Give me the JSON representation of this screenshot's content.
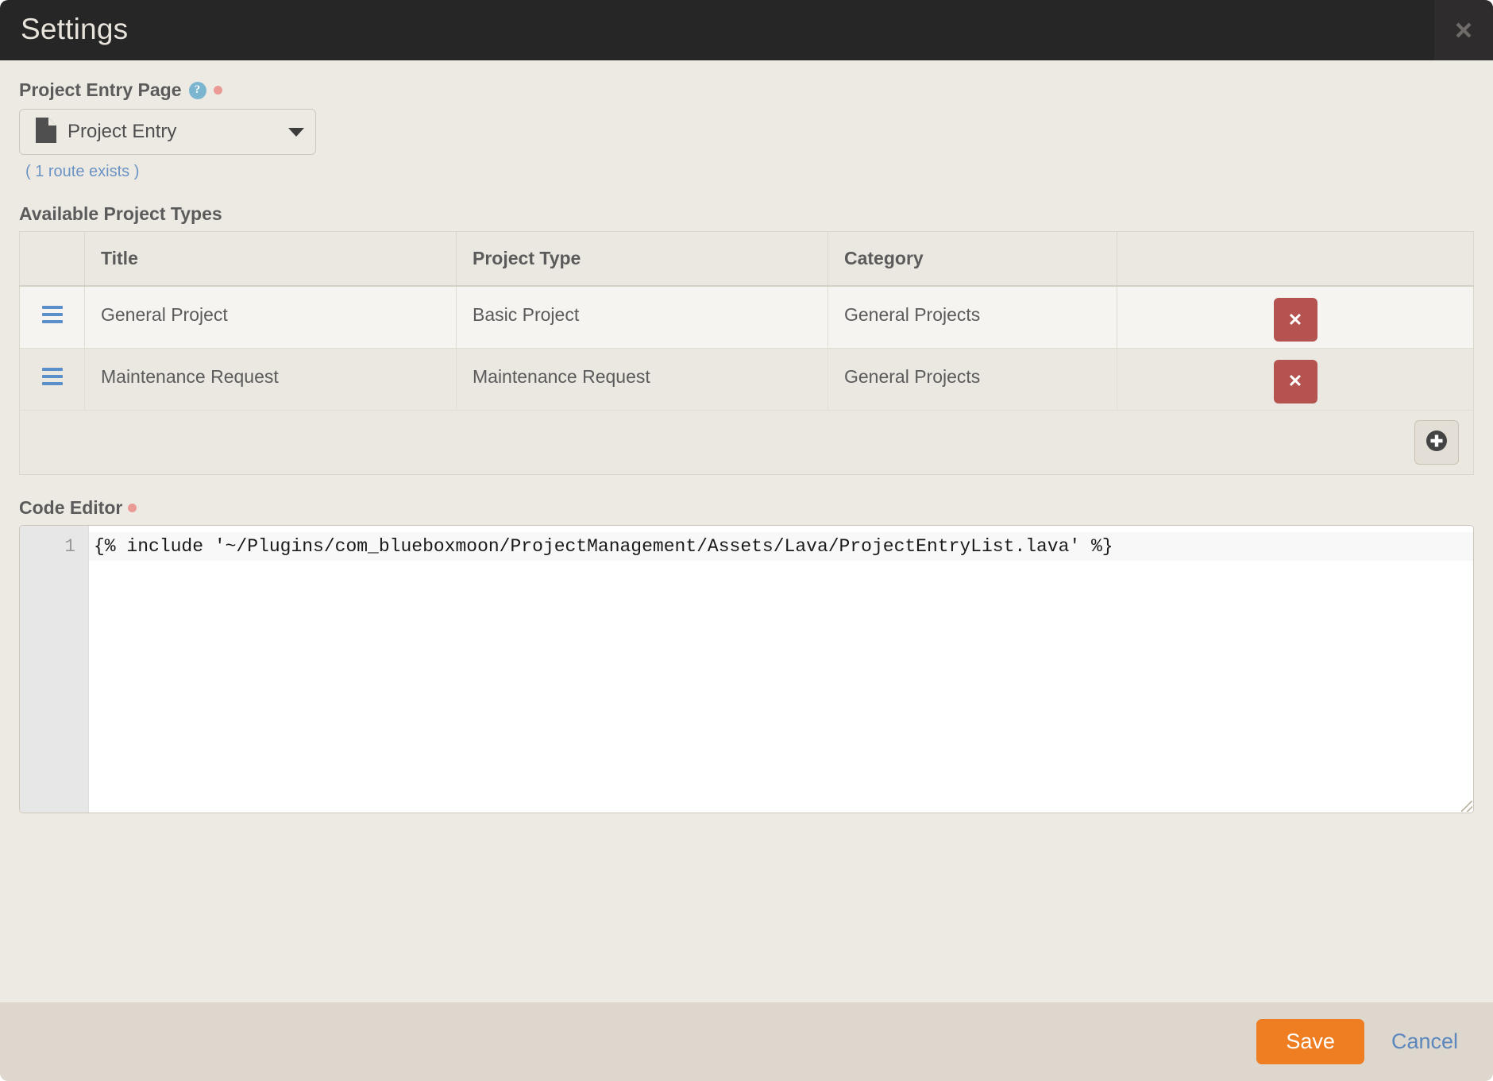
{
  "header": {
    "title": "Settings",
    "close_label": "×",
    "close_icon": "close-icon"
  },
  "page_entry": {
    "label": "Project Entry Page",
    "help_icon_glyph": "?",
    "required": true,
    "picker_icon": "file-icon",
    "picker_value": "Project Entry",
    "caret_icon": "chevron-down-icon",
    "route_note": "( 1 route exists )"
  },
  "project_types": {
    "section_label": "Available Project Types",
    "columns": [
      "",
      "Title",
      "Project Type",
      "Category",
      ""
    ],
    "rows": [
      {
        "handle_icon": "drag-handle-icon",
        "title": "General Project",
        "project_type": "Basic Project",
        "category": "General Projects",
        "delete_label": "✕"
      },
      {
        "handle_icon": "drag-handle-icon",
        "title": "Maintenance Request",
        "project_type": "Maintenance Request",
        "category": "General Projects",
        "delete_label": "✕"
      }
    ],
    "add_icon": "plus-circle-icon"
  },
  "code_editor": {
    "label": "Code Editor",
    "required": true,
    "line_numbers": [
      "1"
    ],
    "lines": [
      "{% include '~/Plugins/com_blueboxmoon/ProjectManagement/Assets/Lava/ProjectEntryList.lava' %}"
    ]
  },
  "footer": {
    "save_label": "Save",
    "cancel_label": "Cancel"
  },
  "colors": {
    "header_bg": "#262626",
    "body_bg": "#edeae4",
    "footer_bg": "#ded7ce",
    "accent_save": "#ef7d22",
    "link": "#5b87bd",
    "delete": "#b4534f",
    "handle": "#5b8fc9",
    "help": "#7cb5d0",
    "required_dot": "#ea9a94"
  }
}
